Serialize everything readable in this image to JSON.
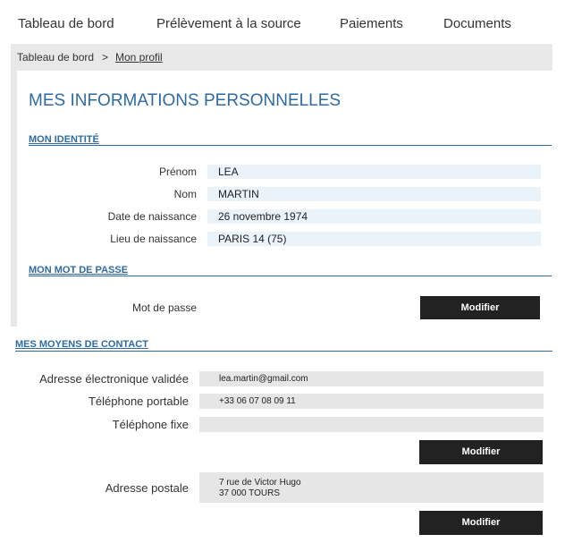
{
  "nav": {
    "items": [
      "Tableau de bord",
      "Prélèvement à la source",
      "Paiements",
      "Documents"
    ]
  },
  "breadcrumb": {
    "home": "Tableau de bord",
    "separator": ">",
    "current": "Mon profil"
  },
  "page_title": "MES INFORMATIONS PERSONNELLES",
  "identity": {
    "title": "MON IDENTITÉ",
    "fields": [
      {
        "label": "Prénom",
        "value": "LEA"
      },
      {
        "label": "Nom",
        "value": "MARTIN"
      },
      {
        "label": "Date de naissance",
        "value": "26 novembre 1974"
      },
      {
        "label": "Lieu de naissance",
        "value": "PARIS 14 (75)"
      }
    ]
  },
  "password": {
    "title": "MON MOT DE PASSE",
    "label": "Mot de passe",
    "button": "Modifier"
  },
  "contact": {
    "title": "MES MOYENS DE CONTACT",
    "email_label": "Adresse électronique validée",
    "email_value": "lea.martin@gmail.com",
    "mobile_label": "Téléphone portable",
    "mobile_value": "+33 06 07 08 09 11",
    "landline_label": "Téléphone fixe",
    "landline_value": "",
    "contact_button": "Modifier",
    "address_label": "Adresse postale",
    "address_line1": "7 rue de Victor Hugo",
    "address_line2": "37 000 TOURS",
    "address_button": "Modifier"
  },
  "colors": {
    "accent": "#2f6aa3",
    "button_bg": "#222222",
    "value_bg": "#eaf2fa",
    "gray_bg": "#e6e6e6"
  }
}
